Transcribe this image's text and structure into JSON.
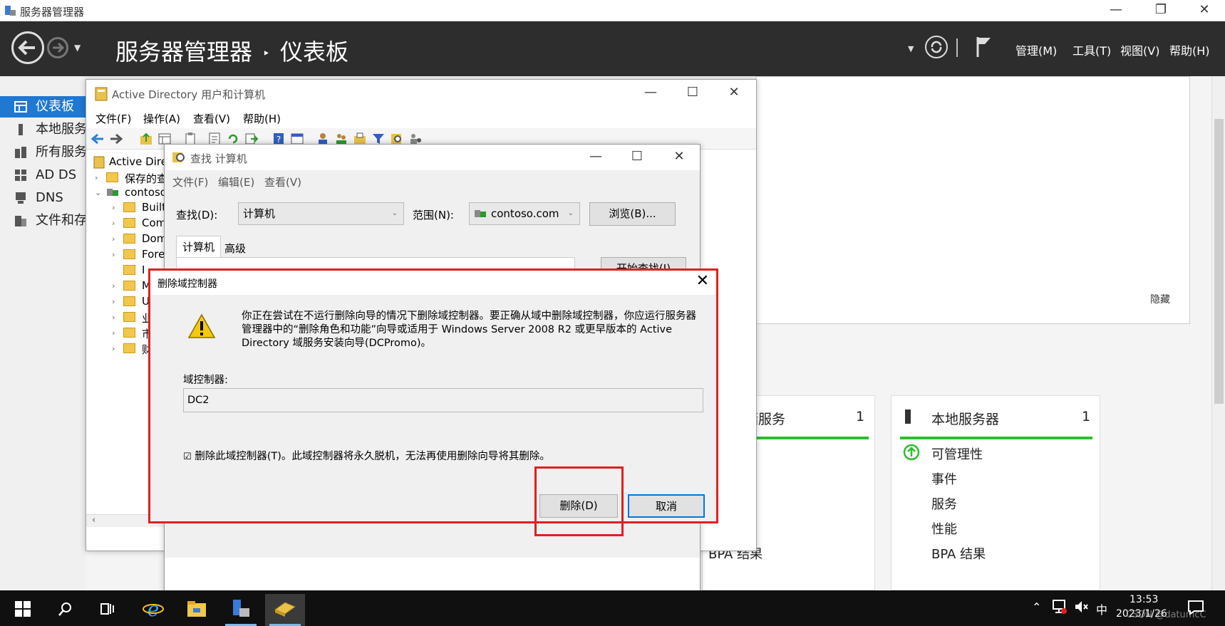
{
  "server_manager": {
    "window_title": "服务器管理器",
    "breadcrumb_root": "服务器管理器",
    "breadcrumb_separator": "‣",
    "breadcrumb_page": "仪表板",
    "menus": [
      "管理(M)",
      "工具(T)",
      "视图(V)",
      "帮助(H)"
    ],
    "sidebar": [
      {
        "label": "仪表板",
        "icon": "dashboard-icon",
        "active": true
      },
      {
        "label": "本地服务",
        "icon": "server-icon"
      },
      {
        "label": "所有服务",
        "icon": "servers-icon"
      },
      {
        "label": "AD DS",
        "icon": "adds-icon"
      },
      {
        "label": "DNS",
        "icon": "dns-icon"
      },
      {
        "label": "文件和存",
        "icon": "file-storage-icon"
      }
    ],
    "hide_link": "隐藏",
    "tile_storage": {
      "title": "存储服务",
      "count": "1",
      "rows": [
        "BPA 结果"
      ]
    },
    "tile_local": {
      "title": "本地服务器",
      "count": "1",
      "rows": [
        "可管理性",
        "事件",
        "服务",
        "性能",
        "BPA 结果"
      ]
    },
    "accent": "#1f78d1",
    "status_green": "#2bc02b"
  },
  "aduc": {
    "title": "Active Directory 用户和计算机",
    "menus": [
      "文件(F)",
      "操作(A)",
      "查看(V)",
      "帮助(H)"
    ],
    "tree": [
      {
        "label": "Active Direc",
        "level": 0
      },
      {
        "label": "保存的查",
        "level": 1
      },
      {
        "label": "contoso",
        "level": 1
      },
      {
        "label": "Built",
        "level": 2
      },
      {
        "label": "Com",
        "level": 2
      },
      {
        "label": "Dom",
        "level": 2
      },
      {
        "label": "Fore",
        "level": 2
      },
      {
        "label": "I",
        "level": 2
      },
      {
        "label": "M",
        "level": 2
      },
      {
        "label": "U",
        "level": 2
      },
      {
        "label": "业",
        "level": 2
      },
      {
        "label": "市",
        "level": 2
      },
      {
        "label": "财",
        "level": 2
      }
    ]
  },
  "find_computers": {
    "title": "查找 计算机",
    "menus": [
      "文件(F)",
      "编辑(E)",
      "查看(V)"
    ],
    "find_label": "查找(D):",
    "find_value": "计算机",
    "scope_label": "范围(N):",
    "scope_value": "contoso.com",
    "browse_button": "浏览(B)...",
    "tabs": [
      "计算机",
      "高级"
    ],
    "start_button": "开始查找(I)"
  },
  "delete_dc_dialog": {
    "title": "删除域控制器",
    "message": "你正在尝试在不运行删除向导的情况下删除域控制器。要正确从域中删除域控制器，你应运行服务器管理器中的“删除角色和功能”向导或适用于 Windows Server 2008 R2 或更早版本的 Active Directory 域服务安装向导(DCPromo)。",
    "dc_label": "域控制器:",
    "dc_value": "DC2",
    "checkbox_label": "删除此域控制器(T)。此域控制器将永久脱机，无法再使用删除向导将其删除。",
    "checkbox_checked": true,
    "delete_button": "删除(D)",
    "cancel_button": "取消",
    "highlight_color": "#e02020"
  },
  "taskbar": {
    "tray_ime": "中",
    "time": "13:53",
    "date": "2023/1/26",
    "watermark": "CSDN @datumcC"
  }
}
